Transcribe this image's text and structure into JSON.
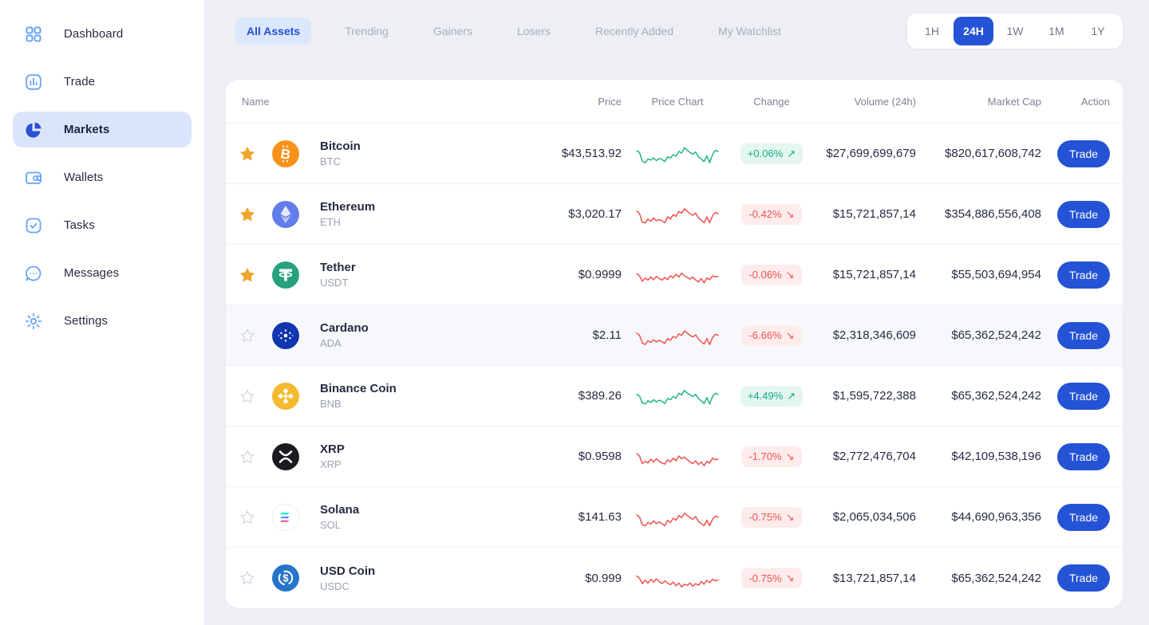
{
  "colors": {
    "accent": "#2553d5",
    "accent_light": "#dbe7fc",
    "sidebar_icon_blue": "#66a3f7",
    "green": "#13ab87",
    "green_bg": "#e4f6ef",
    "red": "#ee5253",
    "red_bg": "#fdeceb",
    "star_gold": "#f0a62c",
    "star_empty": "#d4d8e0"
  },
  "sidebar": {
    "items": [
      {
        "label": "Dashboard",
        "icon": "dashboard-icon",
        "active": false
      },
      {
        "label": "Trade",
        "icon": "trade-icon",
        "active": false
      },
      {
        "label": "Markets",
        "icon": "markets-icon",
        "active": true
      },
      {
        "label": "Wallets",
        "icon": "wallets-icon",
        "active": false
      },
      {
        "label": "Tasks",
        "icon": "tasks-icon",
        "active": false
      },
      {
        "label": "Messages",
        "icon": "messages-icon",
        "active": false
      },
      {
        "label": "Settings",
        "icon": "settings-icon",
        "active": false
      }
    ]
  },
  "tabs": {
    "items": [
      {
        "label": "All Assets",
        "active": true
      },
      {
        "label": "Trending",
        "active": false
      },
      {
        "label": "Gainers",
        "active": false
      },
      {
        "label": "Losers",
        "active": false
      },
      {
        "label": "Recently Added",
        "active": false
      },
      {
        "label": "My Watchlist",
        "active": false
      }
    ]
  },
  "time_filter": {
    "options": [
      {
        "label": "1H",
        "active": false
      },
      {
        "label": "24H",
        "active": true
      },
      {
        "label": "1W",
        "active": false
      },
      {
        "label": "1M",
        "active": false
      },
      {
        "label": "1Y",
        "active": false
      }
    ]
  },
  "table": {
    "columns": [
      "Name",
      "Price",
      "Price Chart",
      "Change",
      "Volume (24h)",
      "Market Cap",
      "Action"
    ],
    "action_label": "Trade",
    "rows": [
      {
        "favorited": true,
        "highlighted": false,
        "coin": {
          "name": "Bitcoin",
          "symbol": "BTC",
          "icon": "btc"
        },
        "price": "$43,513.92",
        "change": {
          "value": "+0.06%",
          "direction": "up"
        },
        "volume": "$27,699,699,679",
        "market_cap": "$820,617,608,742",
        "spark": {
          "trend": "up",
          "points": [
            64,
            58,
            26,
            20,
            34,
            30,
            38,
            28,
            36,
            32,
            24,
            42,
            38,
            50,
            44,
            62,
            56,
            76,
            66,
            58,
            52,
            60,
            42,
            34,
            24,
            46,
            20,
            50,
            66,
            62
          ]
        }
      },
      {
        "favorited": true,
        "highlighted": false,
        "coin": {
          "name": "Ethereum",
          "symbol": "ETH",
          "icon": "eth"
        },
        "price": "$3,020.17",
        "change": {
          "value": "-0.42%",
          "direction": "down"
        },
        "volume": "$15,721,857,14",
        "market_cap": "$354,886,556,408",
        "spark": {
          "trend": "down",
          "points": [
            66,
            56,
            24,
            22,
            36,
            28,
            40,
            30,
            34,
            30,
            22,
            44,
            36,
            52,
            46,
            64,
            58,
            74,
            64,
            56,
            50,
            58,
            40,
            32,
            22,
            44,
            22,
            48,
            60,
            56
          ]
        }
      },
      {
        "favorited": true,
        "highlighted": false,
        "coin": {
          "name": "Tether",
          "symbol": "USDT",
          "icon": "usdt"
        },
        "price": "$0.9999",
        "change": {
          "value": "-0.06%",
          "direction": "down"
        },
        "volume": "$15,721,857,14",
        "market_cap": "$55,503,694,954",
        "spark": {
          "trend": "down",
          "points": [
            58,
            50,
            30,
            42,
            34,
            46,
            36,
            48,
            40,
            34,
            44,
            36,
            50,
            42,
            56,
            46,
            60,
            50,
            44,
            38,
            46,
            34,
            28,
            40,
            24,
            42,
            36,
            50,
            46,
            48
          ]
        }
      },
      {
        "favorited": false,
        "highlighted": true,
        "coin": {
          "name": "Cardano",
          "symbol": "ADA",
          "icon": "ada"
        },
        "price": "$2.11",
        "change": {
          "value": "-6.66%",
          "direction": "down"
        },
        "volume": "$2,318,346,609",
        "market_cap": "$65,362,524,242",
        "spark": {
          "trend": "down",
          "points": [
            62,
            54,
            26,
            20,
            34,
            28,
            38,
            30,
            36,
            30,
            24,
            42,
            36,
            50,
            44,
            60,
            54,
            70,
            62,
            54,
            48,
            56,
            40,
            30,
            22,
            42,
            20,
            46,
            58,
            54
          ]
        }
      },
      {
        "favorited": false,
        "highlighted": false,
        "coin": {
          "name": "Binance Coin",
          "symbol": "BNB",
          "icon": "bnb"
        },
        "price": "$389.26",
        "change": {
          "value": "+4.49%",
          "direction": "up"
        },
        "volume": "$1,595,722,388",
        "market_cap": "$65,362,524,242",
        "spark": {
          "trend": "up",
          "points": [
            60,
            54,
            28,
            24,
            36,
            30,
            40,
            32,
            38,
            34,
            26,
            44,
            40,
            52,
            46,
            64,
            58,
            74,
            64,
            58,
            52,
            60,
            44,
            36,
            26,
            48,
            24,
            52,
            64,
            60
          ]
        }
      },
      {
        "favorited": false,
        "highlighted": false,
        "coin": {
          "name": "XRP",
          "symbol": "XRP",
          "icon": "xrp"
        },
        "price": "$0.9598",
        "change": {
          "value": "-1.70%",
          "direction": "down"
        },
        "volume": "$2,772,476,704",
        "market_cap": "$42,109,538,196",
        "spark": {
          "trend": "down",
          "points": [
            64,
            56,
            28,
            36,
            30,
            44,
            34,
            46,
            36,
            30,
            26,
            42,
            34,
            48,
            38,
            56,
            46,
            52,
            42,
            34,
            28,
            38,
            24,
            34,
            20,
            36,
            30,
            48,
            42,
            44
          ]
        }
      },
      {
        "favorited": false,
        "highlighted": false,
        "coin": {
          "name": "Solana",
          "symbol": "SOL",
          "icon": "sol"
        },
        "price": "$141.63",
        "change": {
          "value": "-0.75%",
          "direction": "down"
        },
        "volume": "$2,065,034,506",
        "market_cap": "$44,690,963,356",
        "spark": {
          "trend": "down",
          "points": [
            62,
            54,
            26,
            22,
            34,
            28,
            40,
            30,
            36,
            30,
            22,
            42,
            34,
            50,
            42,
            60,
            52,
            68,
            60,
            52,
            46,
            56,
            38,
            30,
            22,
            42,
            22,
            46,
            58,
            54
          ]
        }
      },
      {
        "favorited": false,
        "highlighted": false,
        "coin": {
          "name": "USD Coin",
          "symbol": "USDC",
          "icon": "usdc"
        },
        "price": "$0.999",
        "change": {
          "value": "-0.75%",
          "direction": "down"
        },
        "volume": "$13,721,857,14",
        "market_cap": "$65,362,524,242",
        "spark": {
          "trend": "down",
          "points": [
            60,
            52,
            32,
            44,
            34,
            48,
            38,
            50,
            40,
            32,
            42,
            34,
            28,
            38,
            24,
            34,
            20,
            30,
            26,
            34,
            22,
            32,
            26,
            40,
            30,
            44,
            36,
            48,
            42,
            46
          ]
        }
      }
    ]
  }
}
